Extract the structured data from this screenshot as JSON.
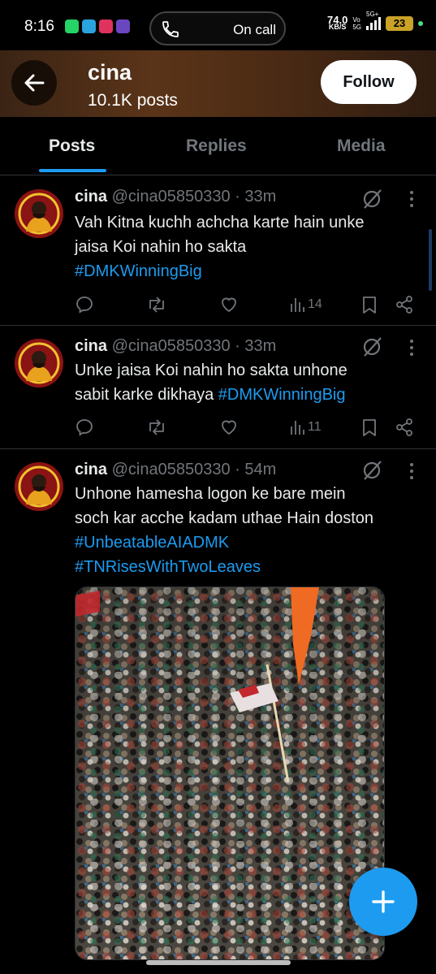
{
  "status_bar": {
    "time": "8:16",
    "call_text": "On call",
    "net_speed_value": "74.0",
    "net_speed_unit": "KB/S",
    "volte_top": "Vo",
    "volte_bottom": "5G",
    "network": "5G+",
    "battery": "23"
  },
  "header": {
    "name": "cina",
    "posts_count": "10.1K posts",
    "follow_label": "Follow"
  },
  "tabs": [
    "Posts",
    "Replies",
    "Media"
  ],
  "posts": [
    {
      "name": "cina",
      "handle": "@cina05850330",
      "separator": " · ",
      "time": "33m",
      "text_lines": [
        "Vah Kitna kuchh achcha karte hain unke",
        "jaisa Koi nahin ho sakta"
      ],
      "hashtags": [
        "#DMKWinningBig"
      ],
      "views": "14"
    },
    {
      "name": "cina",
      "handle": "@cina05850330",
      "separator": " · ",
      "time": "33m",
      "text_lines": [
        "Unke jaisa Koi nahin ho sakta unhone",
        "sabit karke dikhaya "
      ],
      "hashtags": [
        "#DMKWinningBig"
      ],
      "views": "11"
    },
    {
      "name": "cina",
      "handle": "@cina05850330",
      "separator": " · ",
      "time": "54m",
      "text_lines": [
        "Unhone hamesha logon ke bare mein",
        "soch kar acche kadam uthae Hain doston"
      ],
      "hashtags": [
        "#UnbeatableAIADMK",
        "#TNRisesWithTwoLeaves"
      ],
      "views": ""
    }
  ],
  "colors": {
    "accent": "#1d9bf0",
    "secondary_text": "#71767b",
    "divider": "#2f3336"
  }
}
